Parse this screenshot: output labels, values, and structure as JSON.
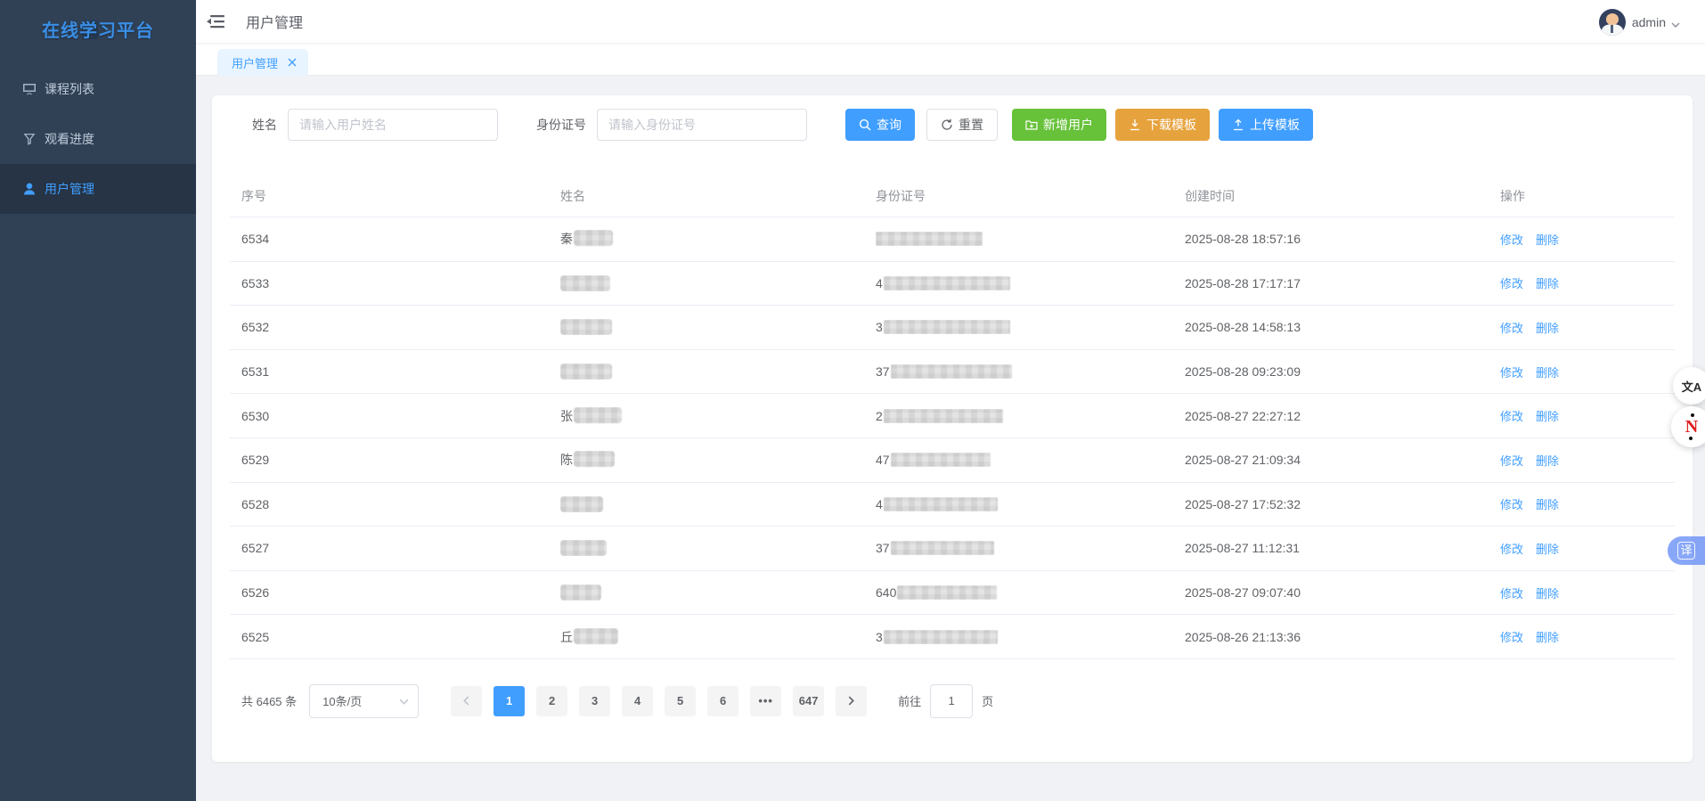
{
  "app": {
    "title": "在线学习平台"
  },
  "colors": {
    "accent": "#409eff",
    "success": "#67c23a",
    "warning": "#e6a23c",
    "sidebar_bg": "#304156",
    "sidebar_active_bg": "#263445",
    "tab_bg": "#e8f4ff"
  },
  "sidebar": {
    "items": [
      {
        "label": "课程列表",
        "icon": "monitor-icon",
        "active": false
      },
      {
        "label": "观看进度",
        "icon": "filter-icon",
        "active": false
      },
      {
        "label": "用户管理",
        "icon": "user-icon",
        "active": true
      }
    ]
  },
  "header": {
    "breadcrumb": "用户管理",
    "fold_icon": "fold-menu-icon",
    "user": {
      "name": "admin",
      "avatar_icon": "person-avatar",
      "caret_icon": "chevron-down-icon"
    }
  },
  "tabs": [
    {
      "label": "用户管理",
      "active": true,
      "closable": true
    }
  ],
  "filters": {
    "name_label": "姓名",
    "name_placeholder": "请输入用户姓名",
    "name_value": "",
    "id_label": "身份证号",
    "id_placeholder": "请输入身份证号",
    "id_value": ""
  },
  "toolbar": {
    "search": "查询",
    "reset": "重置",
    "add": "新增用户",
    "download": "下载模板",
    "upload": "上传模板",
    "icons": {
      "search": "magnifier-icon",
      "reset": "refresh-icon",
      "add": "folder-plus-icon",
      "download": "download-icon",
      "upload": "upload-icon"
    }
  },
  "table": {
    "columns": [
      "序号",
      "姓名",
      "身份证号",
      "创建时间",
      "操作"
    ],
    "actions": {
      "edit": "修改",
      "delete": "删除"
    },
    "rows": [
      {
        "seq": "6534",
        "name_visible": "秦",
        "name_censored": true,
        "id_visible": "",
        "id_censored": true,
        "created": "2025-08-28 18:57:16"
      },
      {
        "seq": "6533",
        "name_visible": "",
        "name_censored": true,
        "id_visible": "4",
        "id_censored": true,
        "created": "2025-08-28 17:17:17"
      },
      {
        "seq": "6532",
        "name_visible": "",
        "name_censored": true,
        "id_visible": "3",
        "id_censored": true,
        "created": "2025-08-28 14:58:13"
      },
      {
        "seq": "6531",
        "name_visible": "",
        "name_censored": true,
        "id_visible": "37",
        "id_censored": true,
        "created": "2025-08-28 09:23:09"
      },
      {
        "seq": "6530",
        "name_visible": "张",
        "name_censored": true,
        "id_visible": "2",
        "id_censored": true,
        "created": "2025-08-27 22:27:12"
      },
      {
        "seq": "6529",
        "name_visible": "陈",
        "name_censored": true,
        "id_visible": "47",
        "id_censored": true,
        "created": "2025-08-27 21:09:34"
      },
      {
        "seq": "6528",
        "name_visible": "",
        "name_censored": true,
        "id_visible": "4",
        "id_censored": true,
        "created": "2025-08-27 17:52:32"
      },
      {
        "seq": "6527",
        "name_visible": "",
        "name_censored": true,
        "id_visible": "37",
        "id_censored": true,
        "created": "2025-08-27 11:12:31"
      },
      {
        "seq": "6526",
        "name_visible": "",
        "name_censored": true,
        "id_visible": "640",
        "id_censored": true,
        "created": "2025-08-27 09:07:40"
      },
      {
        "seq": "6525",
        "name_visible": "丘",
        "name_censored": true,
        "id_visible": "3",
        "id_censored": true,
        "created": "2025-08-26 21:13:36"
      }
    ]
  },
  "pagination": {
    "total_text": "共 6465 条",
    "page_size": "10条/页",
    "pages": [
      "1",
      "2",
      "3",
      "4",
      "5",
      "6",
      "•••",
      "647"
    ],
    "active_page": "1",
    "prev_icon": "chevron-left-icon",
    "next_icon": "chevron-right-icon",
    "goto_label": "前往",
    "goto_value": "1",
    "goto_suffix": "页"
  },
  "overlay": {
    "translate_icon_text": "文A",
    "network_icon": "red-n-graph-icon",
    "translate_badge": "译"
  }
}
